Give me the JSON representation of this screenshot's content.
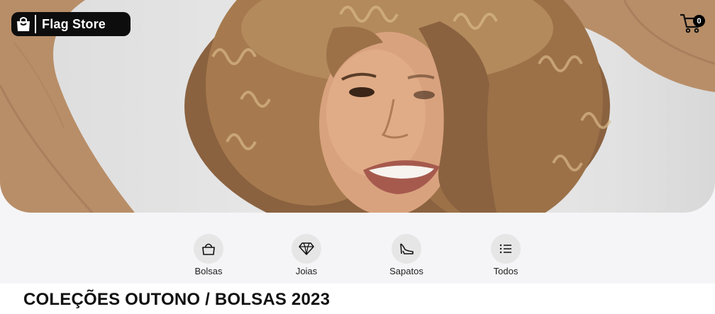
{
  "header": {
    "brand_name": "Flag Store",
    "brand_icon": "shopping-bag-icon",
    "cart_icon": "shopping-cart-icon",
    "cart_count": "0"
  },
  "hero": {
    "image": "woman with curly hair smiling, hands in hair, tan sweater"
  },
  "categories": [
    {
      "label": "Bolsas",
      "icon": "handbag-icon"
    },
    {
      "label": "Joias",
      "icon": "diamond-icon"
    },
    {
      "label": "Sapatos",
      "icon": "high-heel-icon"
    },
    {
      "label": "Todos",
      "icon": "list-icon"
    }
  ],
  "section": {
    "title": "COLEÇÕES OUTONO / BOLSAS 2023"
  },
  "colors": {
    "brand_bg": "#0d0d0d",
    "page_bg": "#f5f5f7",
    "category_circle": "#e6e6e6",
    "sweater": "#b88e68"
  }
}
